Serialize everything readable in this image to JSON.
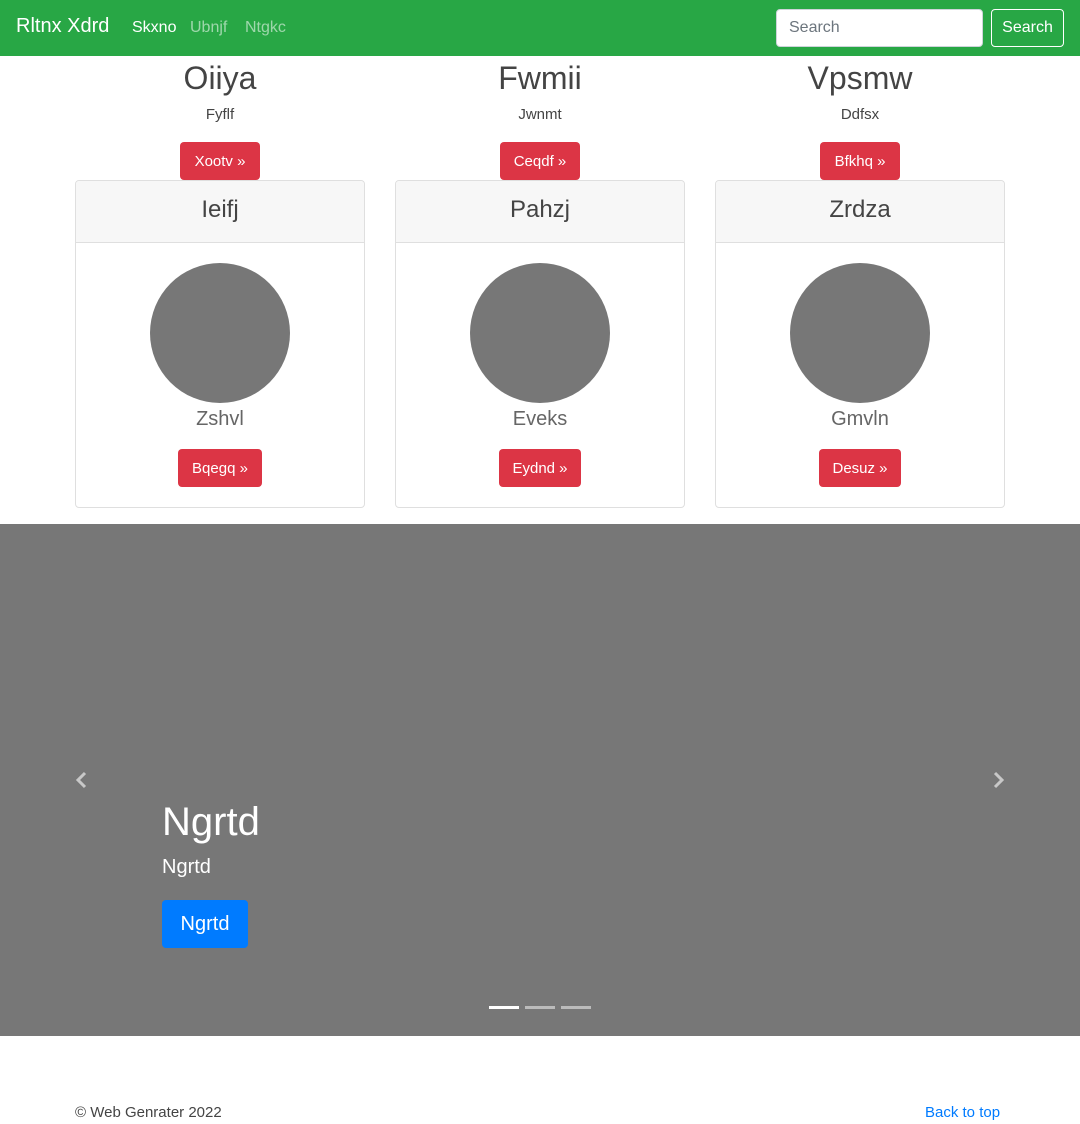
{
  "navbar": {
    "brand": "Rltnx Xdrd",
    "links": [
      {
        "label": "Skxno",
        "active": true
      },
      {
        "label": "Ubnjf",
        "active": false
      },
      {
        "label": "Ntgkc",
        "active": false
      }
    ],
    "search_placeholder": "Search",
    "search_button": "Search"
  },
  "features": [
    {
      "title": "Oiiya",
      "subtitle": "Fyflf",
      "button": "Xootv »"
    },
    {
      "title": "Fwmii",
      "subtitle": "Jwnmt",
      "button": "Ceqdf »"
    },
    {
      "title": "Vpsmw",
      "subtitle": "Ddfsx",
      "button": "Bfkhq »"
    }
  ],
  "cards": [
    {
      "header": "Ieifj",
      "name": "Zshvl",
      "button": "Bqegq »"
    },
    {
      "header": "Pahzj",
      "name": "Eveks",
      "button": "Eydnd »"
    },
    {
      "header": "Zrdza",
      "name": "Gmvln",
      "button": "Desuz »"
    }
  ],
  "carousel": {
    "title": "Ngrtd",
    "subtitle": "Ngrtd",
    "button": "Ngrtd",
    "active_slide": 1,
    "slide_count": 3
  },
  "footer": {
    "copyright": "© Web Genrater 2022",
    "back_to_top": "Back to top"
  },
  "colors": {
    "navbar": "#28a745",
    "danger": "#dc3545",
    "primary": "#007bff",
    "placeholder": "#777777"
  },
  "icons": {
    "prev": "chevron-left-icon",
    "next": "chevron-right-icon"
  }
}
